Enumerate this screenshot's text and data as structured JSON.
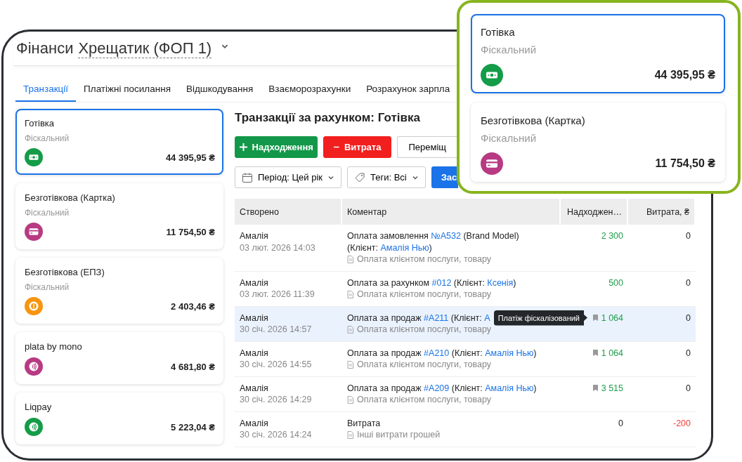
{
  "header": {
    "prefix": "Фінанси",
    "company": "Хрещатик (ФОП 1)"
  },
  "tabs": [
    {
      "label": "Транзакції",
      "selected": true
    },
    {
      "label": "Платіжні посилання",
      "selected": false
    },
    {
      "label": "Відшкодування",
      "selected": false
    },
    {
      "label": "Взаєморозрахунки",
      "selected": false
    },
    {
      "label": "Розрахунок зарпла",
      "selected": false
    }
  ],
  "accounts": [
    {
      "name": "Готівка",
      "subtitle": "Фіскальний",
      "kind": "cash",
      "color": "#149c48",
      "amount": "44 395,95 ₴",
      "selected": true
    },
    {
      "name": "Безготівкова (Картка)",
      "subtitle": "Фіскальний",
      "kind": "card",
      "color": "#b83a83",
      "amount": "11 754,50 ₴",
      "selected": false
    },
    {
      "name": "Безготівкова (ЕПЗ)",
      "subtitle": "Фіскальний",
      "kind": "coin",
      "color": "#f7950f",
      "amount": "2 403,46 ₴",
      "selected": false
    },
    {
      "name": "plata by mono",
      "kind": "contactless",
      "color": "#b83a83",
      "amount": "4 681,80 ₴",
      "selected": false
    },
    {
      "name": "Liqpay",
      "kind": "contactless",
      "color": "#149c48",
      "amount": "5 223,04 ₴",
      "selected": false
    }
  ],
  "main": {
    "heading": "Транзакції за рахунком: Готівка",
    "actions": [
      {
        "kind": "income",
        "label": "Надходження"
      },
      {
        "kind": "expense",
        "label": "Витрата"
      },
      {
        "kind": "transfer",
        "label": "Переміщ"
      }
    ],
    "filters": [
      {
        "kind": "period",
        "label": "Період: Цей рік"
      },
      {
        "kind": "tags",
        "label": "Теги: Всі"
      }
    ],
    "apply": "Зас"
  },
  "table": {
    "columns": [
      "Створено",
      "Коментар",
      "Надходжен…",
      "Витрата, ₴"
    ],
    "rows": [
      {
        "author": "Амалія",
        "date": "03 лют. 2026 14:03",
        "comment": [
          {
            "kind": "text",
            "text": "Оплата замовлення "
          },
          {
            "kind": "link",
            "text": "№A532"
          },
          {
            "kind": "text",
            "text": " (Brand Model) (Клієнт: "
          },
          {
            "kind": "link",
            "text": "Амалія Нью"
          },
          {
            "kind": "text",
            "text": ")"
          }
        ],
        "category": "Оплата клієнтом послуги, товару",
        "fiscal": false,
        "income": {
          "value": "2 300",
          "color": "#1e9e4a"
        },
        "expense": {
          "value": "0"
        },
        "selected": false
      },
      {
        "author": "Амалія",
        "date": "03 лют. 2026 11:39",
        "comment": [
          {
            "kind": "text",
            "text": "Оплата за рахунком "
          },
          {
            "kind": "link",
            "text": "#012"
          },
          {
            "kind": "text",
            "text": " (Клієнт: "
          },
          {
            "kind": "link",
            "text": "Ксенія"
          },
          {
            "kind": "text",
            "text": ")"
          }
        ],
        "category": "Оплата клієнтом послуги, товару",
        "fiscal": false,
        "income": {
          "value": "500",
          "color": "#1e9e4a"
        },
        "expense": {
          "value": "0"
        },
        "selected": false
      },
      {
        "author": "Амалія",
        "date": "30 січ. 2026 14:57",
        "comment": [
          {
            "kind": "text",
            "text": "Оплата за продаж "
          },
          {
            "kind": "link",
            "text": "#A211"
          },
          {
            "kind": "text",
            "text": " (Клієнт: "
          },
          {
            "kind": "link",
            "text": "А"
          }
        ],
        "category": "Оплата клієнтом послуги, товару",
        "fiscal": true,
        "tooltip": "Платіж фіскалізований",
        "income": {
          "value": "1 064",
          "color": "#1e9e4a"
        },
        "expense": {
          "value": "0"
        },
        "selected": true
      },
      {
        "author": "Амалія",
        "date": "30 січ. 2026 14:55",
        "comment": [
          {
            "kind": "text",
            "text": "Оплата за продаж "
          },
          {
            "kind": "link",
            "text": "#A210"
          },
          {
            "kind": "text",
            "text": " (Клієнт: "
          },
          {
            "kind": "link",
            "text": "Амалія Нью"
          },
          {
            "kind": "text",
            "text": ")"
          }
        ],
        "category": "Оплата клієнтом послуги, товару",
        "fiscal": true,
        "income": {
          "value": "1 064",
          "color": "#1e9e4a"
        },
        "expense": {
          "value": "0"
        },
        "selected": false
      },
      {
        "author": "Амалія",
        "date": "30 січ. 2026 14:29",
        "comment": [
          {
            "kind": "text",
            "text": "Оплата за продаж "
          },
          {
            "kind": "link",
            "text": "#A209"
          },
          {
            "kind": "text",
            "text": " (Клієнт: "
          },
          {
            "kind": "link",
            "text": "Амалія Нью"
          },
          {
            "kind": "text",
            "text": ")"
          }
        ],
        "category": "Оплата клієнтом послуги, товару",
        "fiscal": true,
        "income": {
          "value": "3 515",
          "color": "#1e9e4a"
        },
        "expense": {
          "value": "0"
        },
        "selected": false
      },
      {
        "author": "Амалія",
        "date": "30 січ. 2026 14:24",
        "comment": [
          {
            "kind": "text",
            "text": "Витрата"
          }
        ],
        "category": "Інші витрати грошей",
        "fiscal": false,
        "income": {
          "value": "0"
        },
        "expense": {
          "value": "-200",
          "color": "#f0403a"
        },
        "selected": false
      }
    ]
  },
  "callout": {
    "accounts": [
      {
        "name": "Готівка",
        "subtitle": "Фіскальний",
        "kind": "cash",
        "color": "#149c48",
        "amount": "44 395,95 ₴",
        "selected": true
      },
      {
        "name": "Безготівкова (Картка)",
        "subtitle": "Фіскальний",
        "kind": "card",
        "color": "#b83a83",
        "amount": "11 754,50 ₴",
        "selected": false
      }
    ]
  }
}
